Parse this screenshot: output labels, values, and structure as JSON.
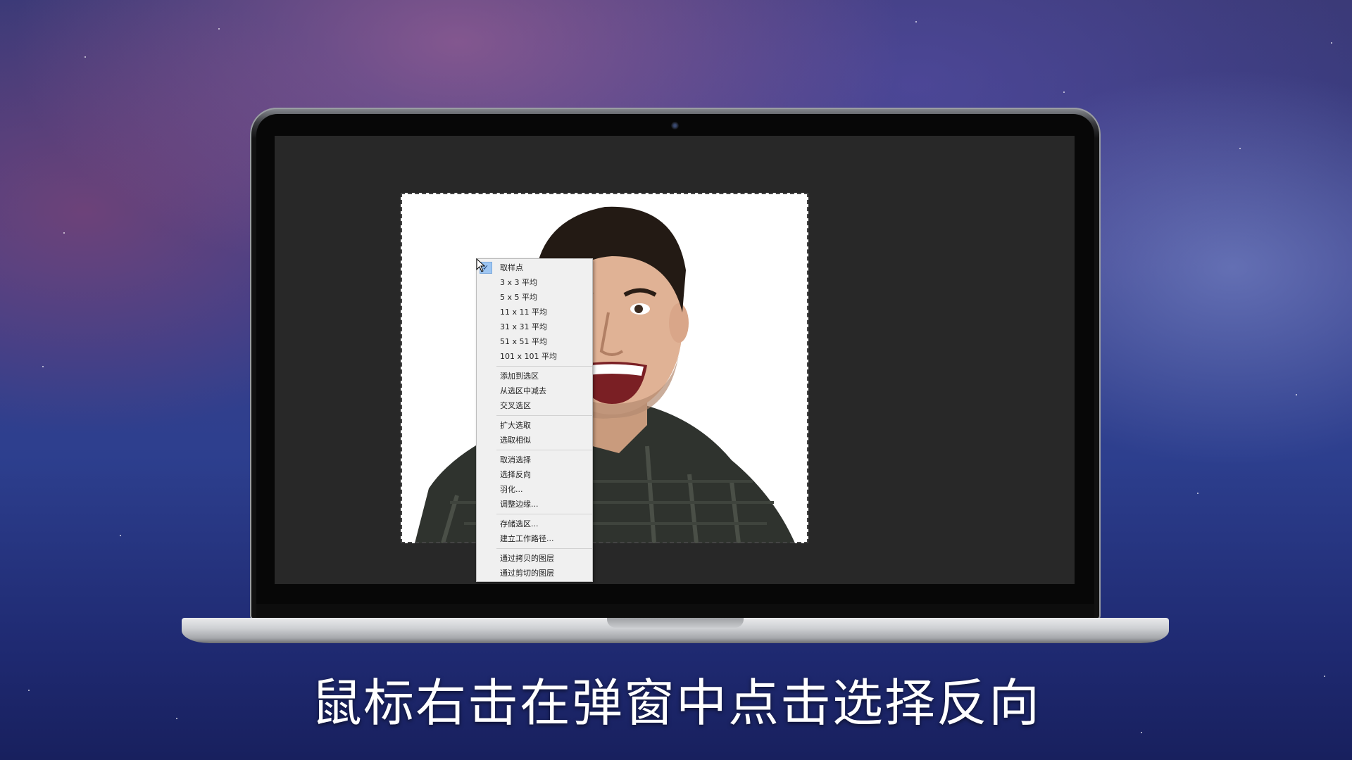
{
  "context_menu": {
    "items": [
      {
        "label": "取样点",
        "checked": true
      },
      {
        "label": "3 x 3 平均"
      },
      {
        "label": "5 x 5 平均"
      },
      {
        "label": "11 x 11 平均"
      },
      {
        "label": "31 x 31 平均"
      },
      {
        "label": "51 x 51 平均"
      },
      {
        "label": "101 x 101 平均"
      },
      {
        "label": "添加到选区"
      },
      {
        "label": "从选区中减去"
      },
      {
        "label": "交叉选区"
      },
      {
        "label": "扩大选取"
      },
      {
        "label": "选取相似"
      },
      {
        "label": "取消选择"
      },
      {
        "label": "选择反向"
      },
      {
        "label": "羽化..."
      },
      {
        "label": "调整边缘..."
      },
      {
        "label": "存储选区..."
      },
      {
        "label": "建立工作路径..."
      },
      {
        "label": "通过拷贝的图层"
      },
      {
        "label": "通过剪切的图层"
      }
    ]
  },
  "caption": "鼠标右击在弹窗中点击选择反向",
  "colors": {
    "workspace_bg": "#282828",
    "menu_bg": "#f0f0f0",
    "menu_highlight": "#9ec6f2"
  }
}
